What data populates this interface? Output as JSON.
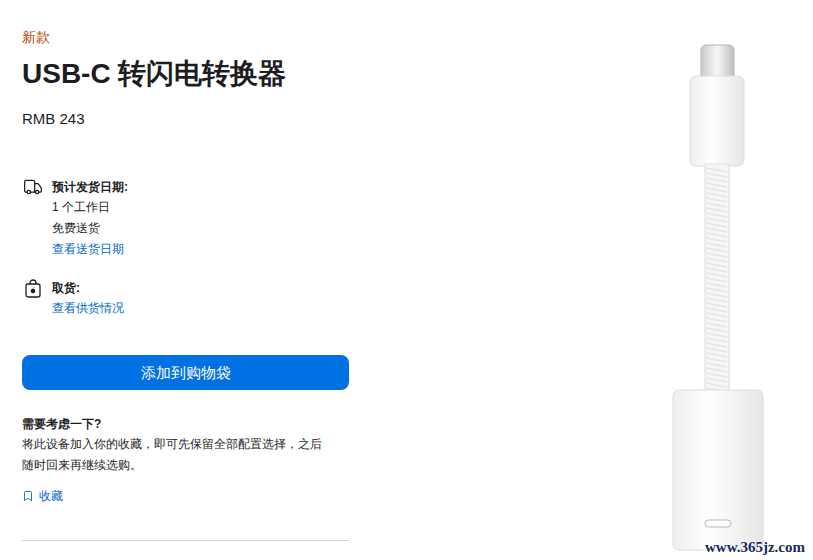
{
  "badge": "新款",
  "title": "USB-C 转闪电转换器",
  "price": "RMB 243",
  "delivery": {
    "label": "预计发货日期:",
    "lines": [
      "1 个工作日",
      "免费送货"
    ],
    "link": "查看送货日期"
  },
  "pickup": {
    "label": "取货:",
    "link": "查看供货情况"
  },
  "add_button": "添加到购物袋",
  "save": {
    "title": "需要考虑一下?",
    "description": [
      "将此设备加入你的收藏，即可先保留全部配置选择，之后",
      "随时回来再继续选购。"
    ],
    "link": "收藏"
  },
  "watermark": "www.365jz.com"
}
